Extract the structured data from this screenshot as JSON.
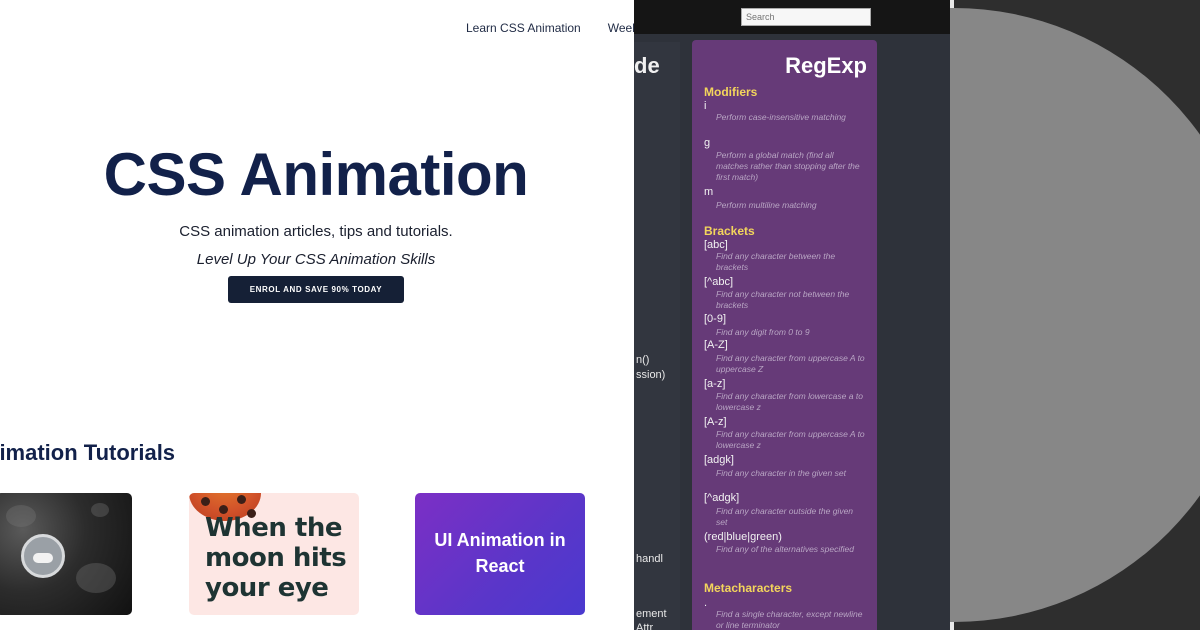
{
  "site": {
    "nav": [
      "Learn CSS Animation",
      "Weekly"
    ],
    "title": "CSS Animation",
    "subtitle": "CSS animation articles, tips and tutorials.",
    "tagline": "Level Up Your CSS Animation Skills",
    "cta": "ENROL AND SAVE 90% TODAY",
    "section_title": "nimation Tutorials",
    "cards": {
      "pizza_text": "When the moon hits your eye",
      "react_text": "UI Animation in React"
    }
  },
  "sheet": {
    "search_placeholder": "Search",
    "left_col": {
      "heading": "de",
      "lines": [
        "n()",
        "ssion)",
        "handl",
        "ement",
        "Attr"
      ]
    },
    "regexp": {
      "heading": "RegExp",
      "modifiers_title": "Modifiers",
      "modifiers": [
        {
          "token": "i",
          "desc": "Perform case-insensitive matching"
        },
        {
          "token": "g",
          "desc": "Perform a global match (find all matches rather than stopping after the first match)"
        },
        {
          "token": "m",
          "desc": "Perform multiline matching"
        }
      ],
      "brackets_title": "Brackets",
      "brackets": [
        {
          "token": "[abc]",
          "desc": "Find any character between the brackets"
        },
        {
          "token": "[^abc]",
          "desc": "Find any character not between the brackets"
        },
        {
          "token": "[0-9]",
          "desc": "Find any digit from 0 to 9"
        },
        {
          "token": "[A-Z]",
          "desc": "Find any character from uppercase A to uppercase Z"
        },
        {
          "token": "[a-z]",
          "desc": "Find any character from lowercase a to lowercase z"
        },
        {
          "token": "[A-z]",
          "desc": "Find any character from uppercase A to lowercase z"
        },
        {
          "token": "[adgk]",
          "desc": "Find any character in the given set"
        },
        {
          "token": "[^adgk]",
          "desc": "Find any character outside the given set"
        },
        {
          "token": "(red|blue|green)",
          "desc": "Find any of the alternatives specified"
        }
      ],
      "meta_title": "Metacharacters",
      "meta": [
        {
          "token": ".",
          "desc": "Find a single character, except newline or line terminator"
        }
      ]
    }
  }
}
